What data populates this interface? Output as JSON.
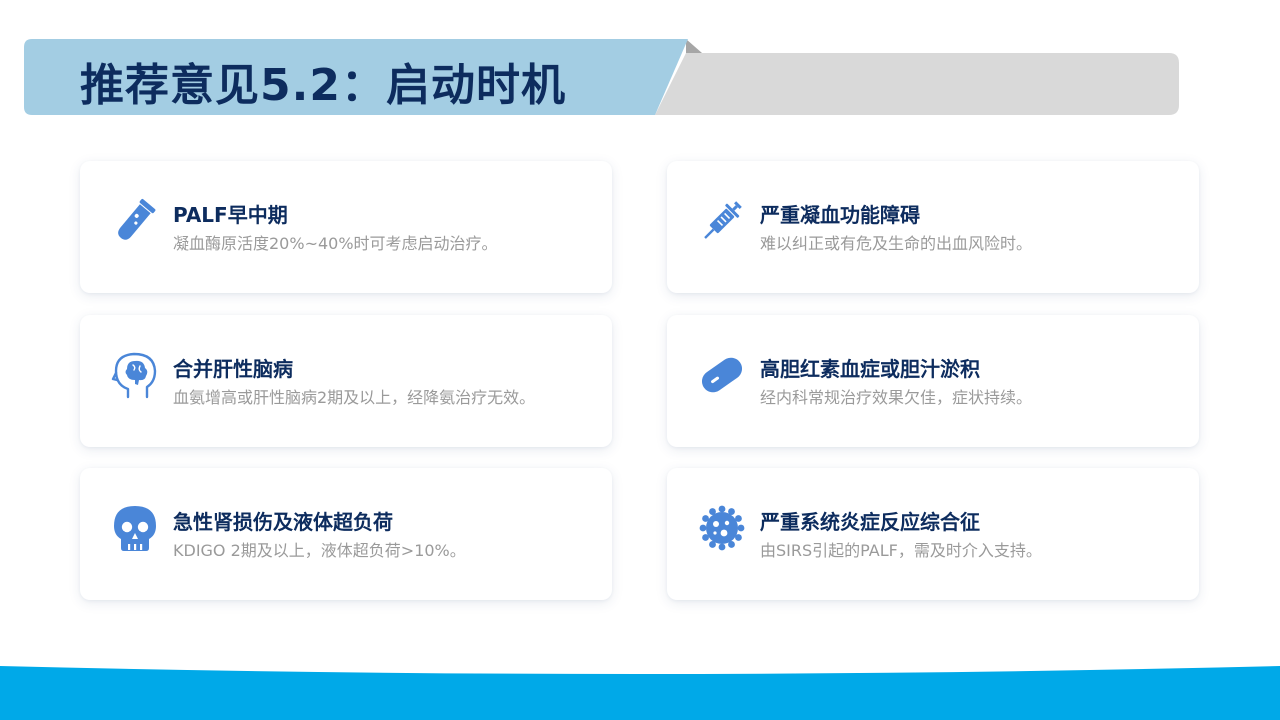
{
  "title": "推荐意见5.2：启动时机",
  "colors": {
    "title_text": "#0d2c5e",
    "banner_blue": "#a3cde3",
    "banner_gray": "#d9d9d9",
    "icon_blue": "#4a86d8",
    "desc_gray": "#9a9a9a",
    "bottom_wave": "#00a9e8"
  },
  "cards": [
    {
      "icon": "test-tube-icon",
      "title": "PALF早中期",
      "desc": "凝血酶原活度20%~40%时可考虑启动治疗。"
    },
    {
      "icon": "syringe-icon",
      "title": "严重凝血功能障碍",
      "desc": "难以纠正或有危及生命的出血风险时。"
    },
    {
      "icon": "brain-head-icon",
      "title": "合并肝性脑病",
      "desc": "血氨增高或肝性脑病2期及以上，经降氨治疗无效。"
    },
    {
      "icon": "pill-icon",
      "title": "高胆红素血症或胆汁淤积",
      "desc": "经内科常规治疗效果欠佳，症状持续。"
    },
    {
      "icon": "skull-icon",
      "title": "急性肾损伤及液体超负荷",
      "desc": "KDIGO 2期及以上，液体超负荷>10%。"
    },
    {
      "icon": "virus-icon",
      "title": "严重系统炎症反应综合征",
      "desc": "由SIRS引起的PALF，需及时介入支持。"
    }
  ]
}
